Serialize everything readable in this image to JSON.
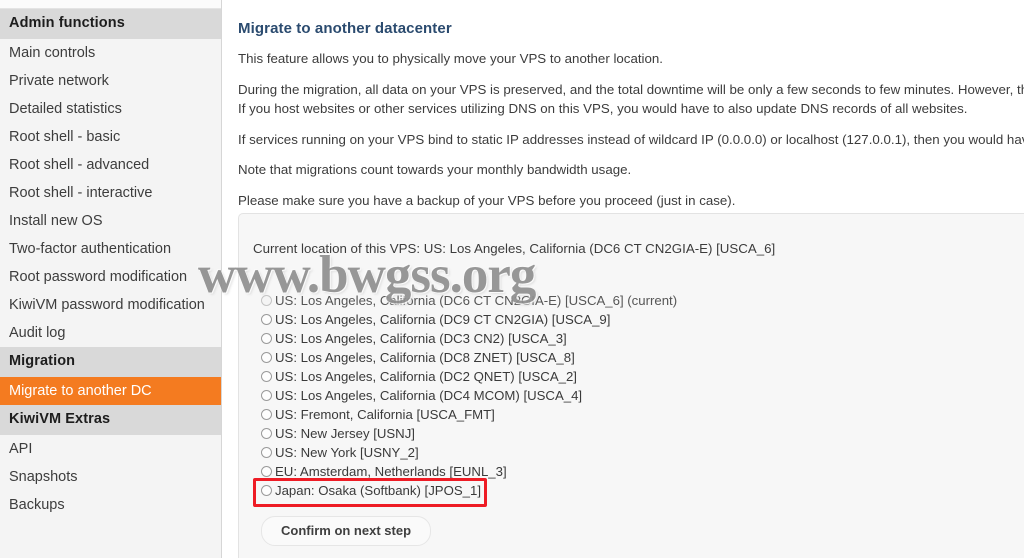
{
  "sidebar": {
    "groups": [
      {
        "title": "Admin functions",
        "items": [
          {
            "label": "Main controls",
            "active": false
          },
          {
            "label": "Private network",
            "active": false
          },
          {
            "label": "Detailed statistics",
            "active": false
          },
          {
            "label": "Root shell - basic",
            "active": false
          },
          {
            "label": "Root shell - advanced",
            "active": false
          },
          {
            "label": "Root shell - interactive",
            "active": false
          },
          {
            "label": "Install new OS",
            "active": false
          },
          {
            "label": "Two-factor authentication",
            "active": false
          },
          {
            "label": "Root password modification",
            "active": false
          },
          {
            "label": "KiwiVM password modification",
            "active": false
          },
          {
            "label": "Audit log",
            "active": false
          }
        ]
      },
      {
        "title": "Migration",
        "items": [
          {
            "label": "Migrate to another DC",
            "active": true
          }
        ]
      },
      {
        "title": "KiwiVM Extras",
        "items": [
          {
            "label": "API",
            "active": false
          },
          {
            "label": "Snapshots",
            "active": false
          },
          {
            "label": "Backups",
            "active": false
          }
        ]
      }
    ]
  },
  "main": {
    "title": "Migrate to another datacenter",
    "paragraphs": [
      "This feature allows you to physically move your VPS to another location.",
      "During the migration, all data on your VPS is preserved, and the total downtime will be only a few seconds to few minutes. However, the I",
      "If you host websites or other services utilizing DNS on this VPS, you would have to also update DNS records of all websites.",
      "If services running on your VPS bind to static IP addresses instead of wildcard IP (0.0.0.0) or localhost (127.0.0.1), then you would have t",
      "Note that migrations count towards your monthly bandwidth usage.",
      "Please make sure you have a backup of your VPS before you proceed (just in case)."
    ]
  },
  "panel": {
    "current_location_text": "Current location of this VPS: US: Los Angeles, California (DC6 CT CN2GIA-E) [USCA_6]",
    "datacenters": [
      {
        "label": "US: Los Angeles, California (DC6 CT CN2GIA-E) [USCA_6] (current)",
        "current": true
      },
      {
        "label": "US: Los Angeles, California (DC9 CT CN2GIA) [USCA_9]",
        "current": false
      },
      {
        "label": "US: Los Angeles, California (DC3 CN2) [USCA_3]",
        "current": false
      },
      {
        "label": "US: Los Angeles, California (DC8 ZNET) [USCA_8]",
        "current": false
      },
      {
        "label": "US: Los Angeles, California (DC2 QNET) [USCA_2]",
        "current": false
      },
      {
        "label": "US: Los Angeles, California (DC4 MCOM) [USCA_4]",
        "current": false
      },
      {
        "label": "US: Fremont, California [USCA_FMT]",
        "current": false
      },
      {
        "label": "US: New Jersey [USNJ]",
        "current": false
      },
      {
        "label": "US: New York [USNY_2]",
        "current": false
      },
      {
        "label": "EU: Amsterdam, Netherlands [EUNL_3]",
        "current": false
      },
      {
        "label": "Japan: Osaka (Softbank) [JPOS_1]",
        "current": false,
        "highlighted": true
      }
    ],
    "confirm_button": "Confirm on next step"
  },
  "watermark": {
    "text": "www.bwgss.org"
  },
  "colors": {
    "sidebar_active": "#f47b20",
    "sidebar_section_bg": "#d9d9d9",
    "heading": "#2b4b6f",
    "highlight_box": "#ee1c25",
    "panel_bg": "#f7f7f7"
  }
}
